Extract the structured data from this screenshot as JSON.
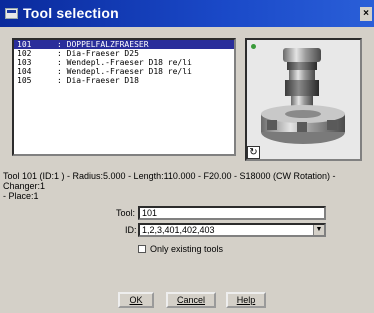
{
  "window": {
    "title": "Tool selection",
    "close_glyph": "×"
  },
  "tool_list": [
    {
      "number": "101",
      "name": ": DOPPELFALZFRAESER",
      "selected": true
    },
    {
      "number": "102",
      "name": ": Dia-Fraeser D25",
      "selected": false
    },
    {
      "number": "103",
      "name": ": Wendepl.-Fraeser D18 re/li",
      "selected": false
    },
    {
      "number": "104",
      "name": ": Wendepl.-Fraeser D18 re/li",
      "selected": false
    },
    {
      "number": "105",
      "name": ": Dia-Fraeser D18",
      "selected": false
    }
  ],
  "preview": {
    "refresh_glyph": "↻",
    "status_color": "#3a9a3a"
  },
  "info": {
    "line1": "Tool 101 (ID:1 ) - Radius:5.000 - Length:110.000 - F20.00 - S18000 (CW Rotation) -",
    "line2": "Changer:1",
    "line3": " - Place:1"
  },
  "form": {
    "tool_label": "Tool:",
    "tool_value": "101",
    "id_label": "ID:",
    "id_value": "1,2,3,401,402,403",
    "only_existing_label": "Only existing tools",
    "only_existing_checked": false
  },
  "buttons": {
    "ok": "OK",
    "cancel": "Cancel",
    "help": "Help"
  },
  "colors": {
    "titlebar": "#1a49c8",
    "selection": "#2a2e9a",
    "face": "#d4d0c8"
  }
}
